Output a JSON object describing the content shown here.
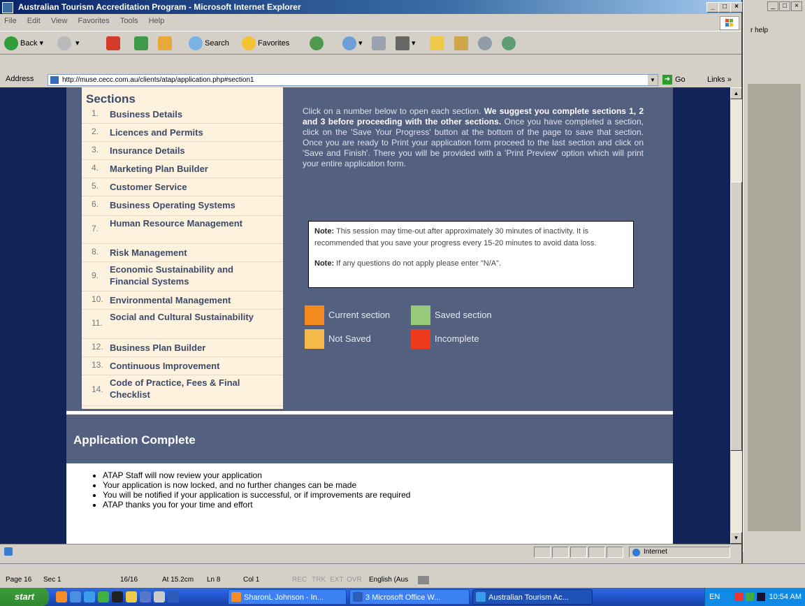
{
  "window": {
    "title": "Australian Tourism Accreditation Program - Microsoft Internet Explorer",
    "controls": [
      "_",
      "□",
      "×"
    ]
  },
  "menu": [
    "File",
    "Edit",
    "View",
    "Favorites",
    "Tools",
    "Help"
  ],
  "toolbar": {
    "back": "Back",
    "search": "Search",
    "favorites": "Favorites"
  },
  "address": {
    "label": "Address",
    "url": "http://muse.cecc.com.au/clients/atap/application.php#section1",
    "go": "Go",
    "links": "Links"
  },
  "sections": {
    "heading": "Sections",
    "items": [
      {
        "num": "1.",
        "label": "Business Details"
      },
      {
        "num": "2.",
        "label": "Licences and Permits"
      },
      {
        "num": "3.",
        "label": "Insurance Details"
      },
      {
        "num": "4.",
        "label": "Marketing Plan Builder"
      },
      {
        "num": "5.",
        "label": "Customer Service"
      },
      {
        "num": "6.",
        "label": "Business Operating Systems"
      },
      {
        "num": "7.",
        "label": "Human Resource Management"
      },
      {
        "num": "8.",
        "label": "Risk Management"
      },
      {
        "num": "9.",
        "label": "Economic Sustainability and Financial Systems"
      },
      {
        "num": "10.",
        "label": "Environmental Management"
      },
      {
        "num": "11.",
        "label": "Social and Cultural Sustainability"
      },
      {
        "num": "12.",
        "label": "Business Plan Builder"
      },
      {
        "num": "13.",
        "label": "Continuous Improvement"
      },
      {
        "num": "14.",
        "label": "Code of Practice, Fees & Final Checklist"
      }
    ]
  },
  "instructions": {
    "part1": "Click on a number below to open each section.",
    "bold": "We suggest you complete sections 1, 2 and 3 before proceeding with the other sections.",
    "part2": "Once you have completed a section, click on the 'Save Your Progress' button at the bottom of the page to save that section. Once you are ready to Print your application form proceed to the last section and click on 'Save and Finish'. There you will be provided with a 'Print Preview' option which will print your entire application form."
  },
  "note": {
    "label1": "Note:",
    "text1": "This session may time-out after approximately 30 minutes of inactivity. It is recommended that you save your progress every 15-20 minutes to avoid data loss.",
    "label2": "Note:",
    "text2": "If any questions do not apply please enter \"N/A\"."
  },
  "legend": [
    {
      "label": "Current section",
      "color": "#f28a1f"
    },
    {
      "label": "Saved section",
      "color": "#97c97a"
    },
    {
      "label": "Not Saved",
      "color": "#f5b94a"
    },
    {
      "label": "Incomplete",
      "color": "#ee3b1e"
    }
  ],
  "complete": {
    "heading": "Application Complete",
    "bullets": [
      "ATAP Staff will now review your application",
      "Your application is now locked, and no further changes can be made",
      "You will be notified if your application is successful, or if improvements are required",
      "ATAP thanks you for your time and effort"
    ]
  },
  "statusbar": {
    "zone": "Internet"
  },
  "word_status": {
    "page": "Page 16",
    "sec": "Sec 1",
    "pages": "16/16",
    "at": "At 15.2cm",
    "ln": "Ln 8",
    "col": "Col 1",
    "rec": "REC",
    "trk": "TRK",
    "ext": "EXT",
    "ovr": "OVR",
    "lang": "English (Aus"
  },
  "bg_window": {
    "help": "r help",
    "controls": [
      "_",
      "□",
      "×"
    ]
  },
  "taskbar": {
    "start": "start",
    "tasks": [
      "SharonL Johnson - In...",
      "3 Microsoft Office W...",
      "Australian Tourism Ac..."
    ],
    "lang": "EN",
    "time": "10:54 AM"
  }
}
